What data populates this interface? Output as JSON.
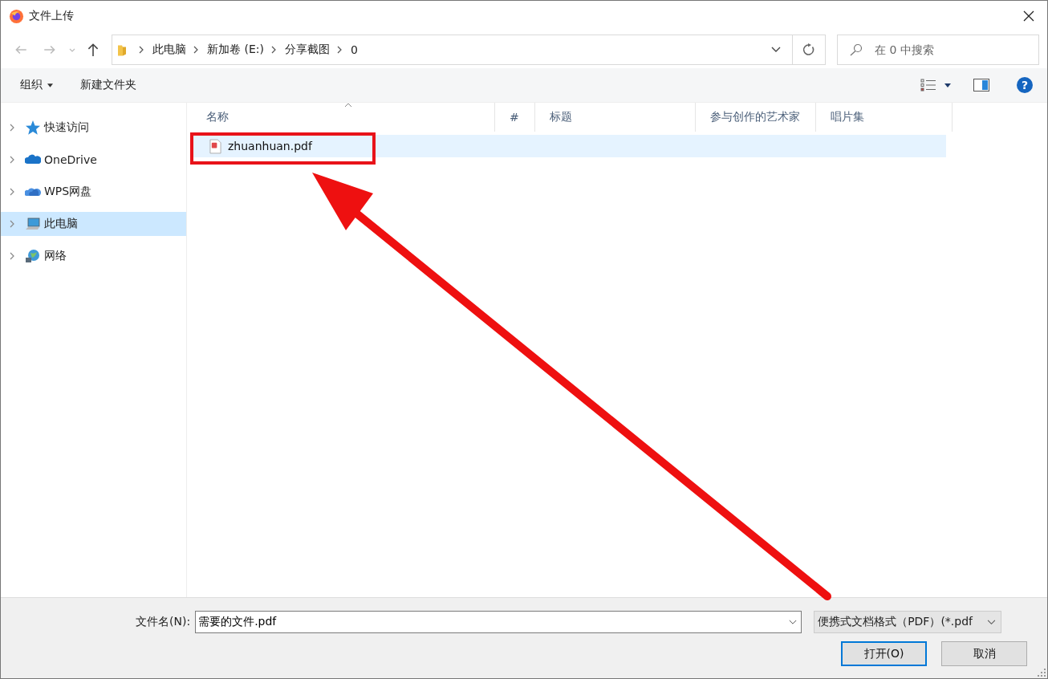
{
  "window": {
    "title": "文件上传"
  },
  "address_bar": {
    "crumbs": [
      "此电脑",
      "新加卷 (E:)",
      "分享截图",
      "0"
    ]
  },
  "search": {
    "placeholder": "在 0 中搜索"
  },
  "toolbar": {
    "organize": "组织",
    "new_folder": "新建文件夹",
    "help": "?"
  },
  "sidebar": {
    "items": [
      {
        "label": "快速访问",
        "kind": "star",
        "selected": false
      },
      {
        "label": "OneDrive",
        "kind": "cloud",
        "selected": false
      },
      {
        "label": "WPS网盘",
        "kind": "wps",
        "selected": false
      },
      {
        "label": "此电脑",
        "kind": "pc",
        "selected": true
      },
      {
        "label": "网络",
        "kind": "network",
        "selected": false
      }
    ]
  },
  "table": {
    "columns": [
      "名称",
      "#",
      "标题",
      "参与创作的艺术家",
      "唱片集"
    ],
    "rows": [
      {
        "name": "zhuanhuan.pdf",
        "selected": true
      }
    ]
  },
  "footer": {
    "filename_label": "文件名(N):",
    "filename_value": "需要的文件.pdf",
    "filetype": "便携式文档格式（PDF）(*.pdf",
    "buttons": [
      {
        "label": "打开(O)",
        "kind": "primary"
      },
      {
        "label": "取消",
        "kind": "normal"
      }
    ]
  }
}
